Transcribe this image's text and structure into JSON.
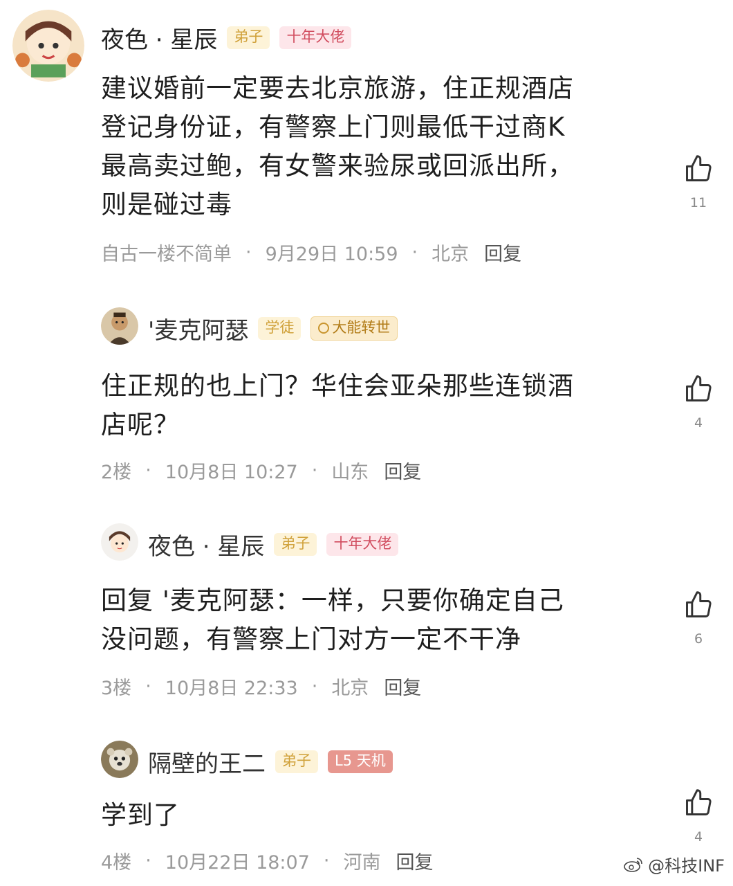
{
  "comments": [
    {
      "username": "夜色 · 星辰",
      "badges": [
        "弟子",
        "十年大佬"
      ],
      "text": "建议婚前一定要去北京旅游，住正规酒店\n登记身份证，有警察上门则最低干过商K\n最高卖过鲍，有女警来验尿或回派出所，\n则是碰过毒",
      "floor": "自古一楼不简单",
      "date": "9月29日 10:59",
      "location": "北京",
      "reply_label": "回复",
      "likes": "11"
    },
    {
      "username": "'麦克阿瑟",
      "badges": [
        "学徒",
        "大能转世"
      ],
      "text": "住正规的也上门？华住会亚朵那些连锁酒\n店呢？",
      "floor": "2楼",
      "date": "10月8日 10:27",
      "location": "山东",
      "reply_label": "回复",
      "likes": "4"
    },
    {
      "username": "夜色 · 星辰",
      "badges": [
        "弟子",
        "十年大佬"
      ],
      "text": "回复 '麦克阿瑟：一样，只要你确定自己\n没问题，有警察上门对方一定不干净",
      "floor": "3楼",
      "date": "10月8日 22:33",
      "location": "北京",
      "reply_label": "回复",
      "likes": "6"
    },
    {
      "username": "隔壁的王二",
      "badges": [
        "弟子",
        "L5 天机"
      ],
      "text": "学到了",
      "floor": "4楼",
      "date": "10月22日 18:07",
      "location": "河南",
      "reply_label": "回复",
      "likes": "4"
    }
  ],
  "watermark": "@科技INF",
  "icons": {
    "like": "thumbs-up-icon",
    "watermark": "weibo-icon"
  },
  "colors": {
    "badge_yellow": "#fdf3d8",
    "badge_pink": "#fde6ea",
    "badge_red": "#e7978f"
  }
}
